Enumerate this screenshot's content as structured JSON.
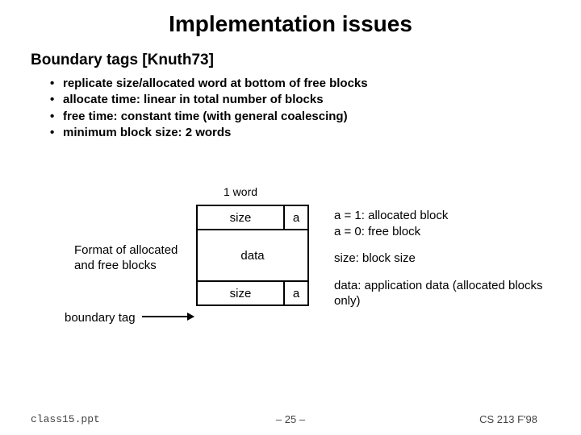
{
  "title": "Implementation issues",
  "subtitle": "Boundary tags [Knuth73]",
  "bullets": [
    "replicate size/allocated word at bottom of free blocks",
    "allocate time: linear in total number of blocks",
    "free time: constant time (with general coalescing)",
    "minimum block size: 2 words"
  ],
  "diagram": {
    "word_label": "1 word",
    "header_size": "size",
    "header_a": "a",
    "data": "data",
    "footer_size": "size",
    "footer_a": "a",
    "format_label": "Format of allocated and free blocks",
    "boundary_label": "boundary tag"
  },
  "legend": {
    "a1": "a = 1: allocated block",
    "a0": "a = 0: free block",
    "size": "size: block size",
    "data": "data: application data (allocated blocks only)"
  },
  "footer": {
    "left": "class15.ppt",
    "center": "– 25 –",
    "right": "CS 213 F'98"
  }
}
